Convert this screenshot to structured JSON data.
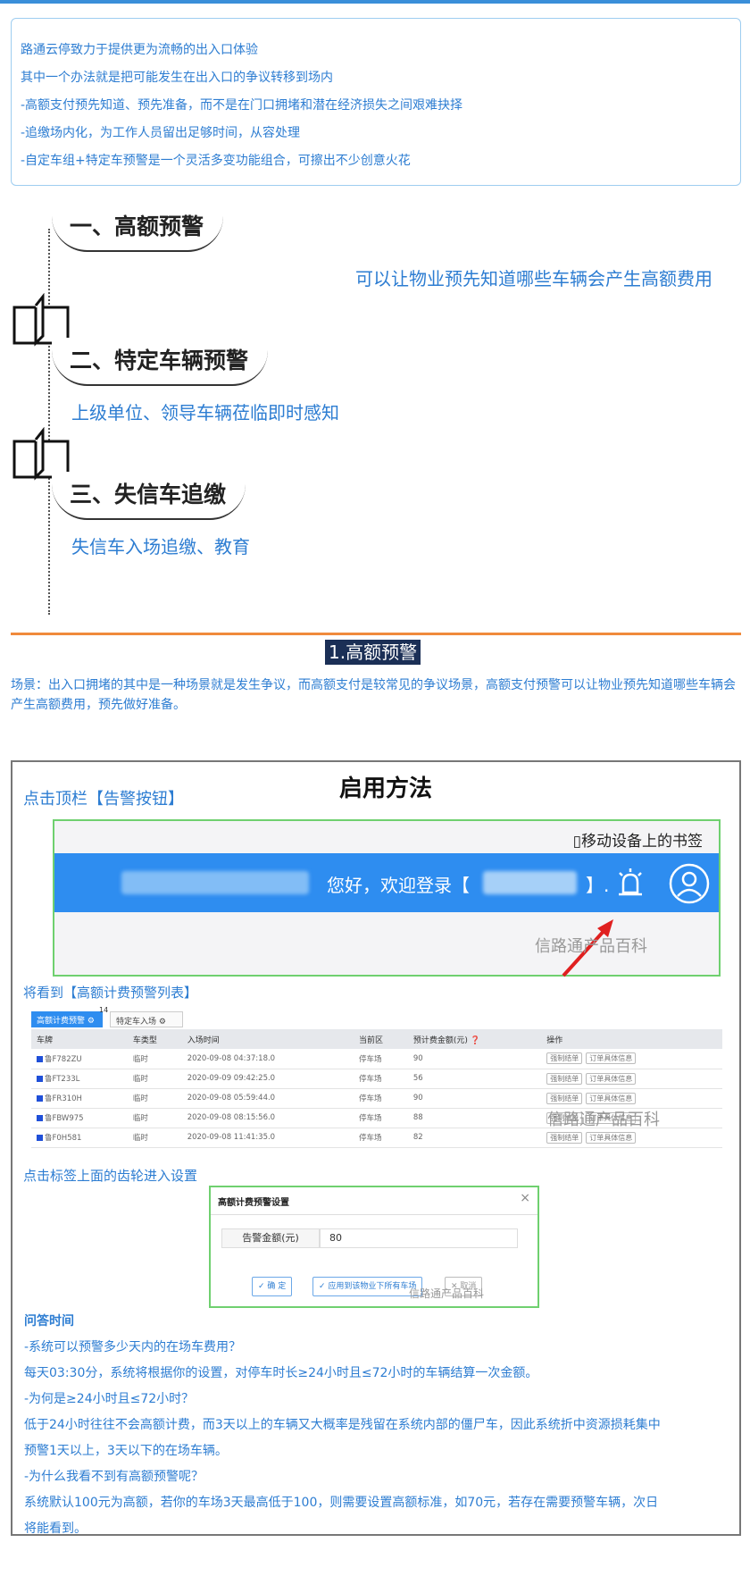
{
  "intro": {
    "lines": [
      "路通云停致力于提供更为流畅的出入口体验",
      "其中一个办法就是把可能发生在出入口的争议转移到场内",
      "-高额支付预先知道、预先准备，而不是在门口拥堵和潜在经济损失之间艰难抉择",
      "-追缴场内化，为工作人员留出足够时间，从容处理",
      "-自定车组+特定车预警是一个灵活多变功能组合，可擦出不少创意火花"
    ]
  },
  "sections": [
    {
      "title": "一、高额预警",
      "desc": "可以让物业预先知道哪些车辆会产生高额费用"
    },
    {
      "title": "二、特定车辆预警",
      "desc": "上级单位、领导车辆莅临即时感知"
    },
    {
      "title": "三、失信车追缴",
      "desc": "失信车入场追缴、教育"
    }
  ],
  "heading": "1.高额预警",
  "scene": "场景：出入口拥堵的其中是一种场景就是发生争议，而高额支付是较常见的争议场景，高额支付预警可以让物业预先知道哪些车辆会产生高额费用，预先做好准备。",
  "method": {
    "title": "启用方法",
    "step1": "点击顶栏【告警按钮】",
    "step2": "将看到【高额计费预警列表】",
    "step3": "点击标签上面的齿轮进入设置"
  },
  "shot1": {
    "bookmark": "▯移动设备上的书签",
    "welcome": "您好，欢迎登录【",
    "close": "】.",
    "watermark": "信路通产品百科"
  },
  "shot2": {
    "tab_active": "高额计费预警 ⚙",
    "tab_badge": "14",
    "tab_normal": "特定车入场 ⚙",
    "columns": [
      "车牌",
      "车类型",
      "入场时间",
      "当前区",
      "预计费金额(元) ❓",
      "操作"
    ],
    "rows": [
      [
        "鲁F782ZU",
        "临时",
        "2020-09-08 04:37:18.0",
        "停车场",
        "90"
      ],
      [
        "鲁FT233L",
        "临时",
        "2020-09-09 09:42:25.0",
        "停车场",
        "56"
      ],
      [
        "鲁FR310H",
        "临时",
        "2020-09-08 05:59:44.0",
        "停车场",
        "90"
      ],
      [
        "鲁FBW975",
        "临时",
        "2020-09-08 08:15:56.0",
        "停车场",
        "88"
      ],
      [
        "鲁F0H581",
        "临时",
        "2020-09-08 11:41:35.0",
        "停车场",
        "82"
      ]
    ],
    "op1": "强制结单",
    "op2": "订单具体信息",
    "watermark": "信路通产品百科"
  },
  "shot3": {
    "title": "高额计费预警设置",
    "close": "×",
    "label": "告警金额(元)",
    "value": "80",
    "btn_ok": "✓ 确 定",
    "btn_apply": "✓ 应用到该物业下所有车场",
    "btn_cancel": "✕ 取消",
    "watermark": "信路通产品百科"
  },
  "qa": {
    "head": "问答时间",
    "lines": [
      "-系统可以预警多少天内的在场车费用？",
      "每天03:30分，系统将根据你的设置，对停车时长≥24小时且≤72小时的车辆结算一次金额。",
      "-为何是≥24小时且≤72小时？",
      "低于24小时往往不会高额计费，而3天以上的车辆又大概率是残留在系统内部的僵尸车，因此系统折中资源损耗集中",
      "预警1天以上，3天以下的在场车辆。",
      "-为什么我看不到有高额预警呢？",
      "系统默认100元为高额，若你的车场3天最高低于100，则需要设置高额标准，如70元，若存在需要预警车辆，次日",
      "将能看到。"
    ]
  },
  "colors": {
    "accent": "#2d7dd2",
    "orange": "#f08a3c",
    "green_border": "#6fd06f",
    "bar_blue": "#2e8df0"
  }
}
